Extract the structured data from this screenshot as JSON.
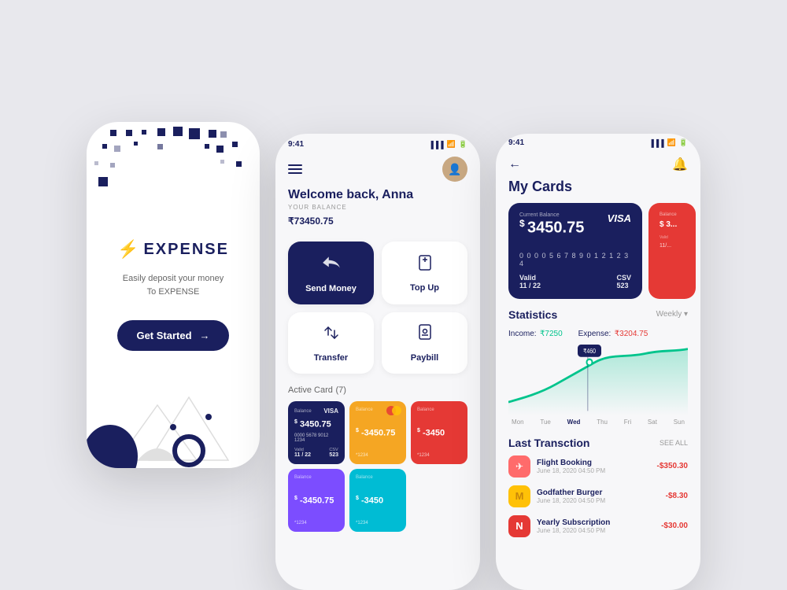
{
  "splash": {
    "brand": "EXPENSE",
    "tagline_line1": "Easily deposit your money",
    "tagline_line2": "To EXPENSE",
    "get_started": "Get Started"
  },
  "main": {
    "status_time": "9:41",
    "welcome": "Welcome back, Anna",
    "balance_label": "YOUR BALANCE",
    "balance_currency": "₹",
    "balance_amount": "73450.75",
    "actions": [
      {
        "label": "Send Money",
        "icon": "✈",
        "dark": true
      },
      {
        "label": "Top Up",
        "icon": "📱",
        "dark": false
      },
      {
        "label": "Transfer",
        "icon": "⇄",
        "dark": false
      },
      {
        "label": "Paybill",
        "icon": "📄",
        "dark": false
      }
    ],
    "active_cards_title": "Active Card",
    "active_cards_count": "7",
    "cards": [
      {
        "type": "VISA",
        "theme": "navy",
        "balance_label": "Balance",
        "balance": "3450.75",
        "number": "0000 5678 9012 1234",
        "valid_label": "Valid",
        "valid": "11/22",
        "csv_label": "CSV",
        "csv": "523"
      },
      {
        "type": "MC",
        "theme": "orange",
        "balance_label": "Balance",
        "balance": "-3450.75",
        "number": "*1234"
      },
      {
        "type": "",
        "theme": "red",
        "balance_label": "Balance",
        "balance": "-3450",
        "number": "*1234"
      },
      {
        "type": "",
        "theme": "purple",
        "balance_label": "Balance",
        "balance": "-3450.75",
        "number": "*1234"
      },
      {
        "type": "teal",
        "theme": "teal",
        "balance_label": "Balance",
        "balance": "-3450",
        "number": "*1234"
      }
    ]
  },
  "stats": {
    "status_time": "9:41",
    "title": "My Cards",
    "featured_card": {
      "balance_label": "Current Balance",
      "balance": "3450.75",
      "number": "0 0 0 0   5 6 7 8   9 0 1 2   1 2 3 4",
      "valid_label": "Valid",
      "valid": "11 / 22",
      "csv_label": "CSV",
      "csv": "523",
      "type": "VISA"
    },
    "peek_card": {
      "label": "Balance",
      "value": "$ 3..."
    },
    "statistics_title": "Statistics",
    "weekly": "Weekly ▾",
    "income_label": "Income:",
    "income_value": "₹7250",
    "expense_label": "Expense:",
    "expense_value": "₹3204.75",
    "chart_days": [
      "Mon",
      "Tue",
      "Wed",
      "Thu",
      "Fri",
      "Sat",
      "Sun"
    ],
    "chart_active_day": "Wed",
    "chart_tooltip": "₹460",
    "last_transaction_title": "Last Transction",
    "see_all": "SEE ALL",
    "transactions": [
      {
        "name": "Flight Booking",
        "date": "June 18, 2020 04:50 PM",
        "amount": "-$350.30",
        "icon": "✈",
        "icon_bg": "#ff6b6b",
        "icon_color": "#fff"
      },
      {
        "name": "Godfather Burger",
        "date": "June 18, 2020 04:50 PM",
        "amount": "-$8.30",
        "icon": "M",
        "icon_bg": "#ffc107",
        "icon_color": "#c8860a"
      },
      {
        "name": "Yearly Subscription",
        "date": "June 18, 2020 04:50 PM",
        "amount": "-$30.00",
        "icon": "N",
        "icon_bg": "#e53935",
        "icon_color": "#fff"
      }
    ]
  }
}
